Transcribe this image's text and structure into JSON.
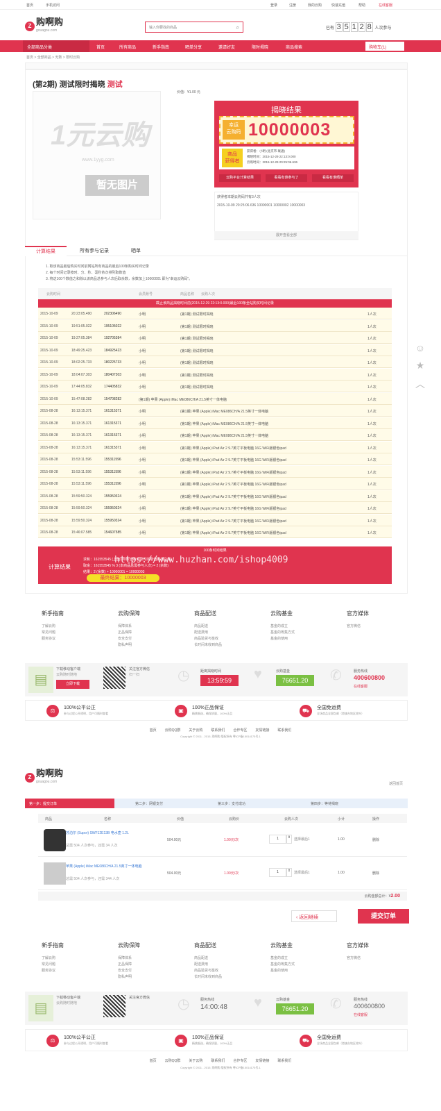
{
  "top_links": {
    "left1": "首页",
    "left2": "手机访问",
    "r1": "登录",
    "r2": "注册",
    "r3": "我的云购",
    "r4": "快速充值",
    "r5": "帮助",
    "r6": "在线客服"
  },
  "logo": {
    "mark": "Z",
    "name": "购啊购",
    "sub": "gouagou.com"
  },
  "search": {
    "placeholder": "输入你要找的商品"
  },
  "counter": {
    "prefix": "已有",
    "digits": [
      "3",
      "5",
      "1",
      "2",
      "8"
    ],
    "suffix": "人次参与"
  },
  "nav": {
    "all": "全部商品分类",
    "items": [
      "首页",
      "所有商品",
      "新手指南",
      "晒单分享",
      "邀请好友",
      "限时揭晓",
      "商品搜索"
    ],
    "cart": "购物车(1)"
  },
  "breadcrumb": "首页 > 全部商品 > 无数 > 限时云购",
  "product": {
    "period": "(第2期)",
    "title": "测试限时揭晓",
    "tag": "测试",
    "price": "价值：¥1.00 元",
    "no_image": "暂无图片",
    "brand": "1元云购",
    "brand_url": "www.1yyg.com"
  },
  "result": {
    "title": "揭晓结果",
    "lucky1": "幸运",
    "lucky2": "云购码",
    "code": "10000003",
    "winner1": "商品",
    "winner2": "获得者",
    "info1": "获得者：小明 (北京市 联通)",
    "info2": "揭晓时间：2015-12-29 22:13:0.000",
    "info3": "云购时间：2015-12-29 20:25:06.636",
    "btn1": "云购平台计算结果",
    "btn2": "看看有谁参与了",
    "btn3": "看看有谁晒单",
    "codes_title": "获得者本期云购码共有3人次",
    "codes": "2015-10-09 20:25:06.636  10000001  10000002  10000003",
    "more": "展开查看全部"
  },
  "tabs": [
    "计算结果",
    "所有参与记录",
    "晒单"
  ],
  "rules": [
    "1. 取该商品最后购买时间前网站所有商品的最后100条购买时间记录",
    "2. 每个时间记录按时、分、秒、毫秒依次排列取数值",
    "3. 将这100个数值之和除以该商品总参与人次后取余数，余数加上10000001 即为\"幸运云购码\"。"
  ],
  "table_header": [
    "云购时间",
    "会员账号",
    "商品名称",
    "云购人次"
  ],
  "table_banner": "截止该商品揭晓时间前(2015-12-29 22:13:0.000)最后100条全站购买时间记录",
  "records": [
    [
      "2015-10-09",
      "20:23:05.490",
      "202306490",
      "小明",
      "(第1期) 测试限时揭晓",
      "1人次"
    ],
    [
      "2015-10-09",
      "19:51:05.022",
      "195105022",
      "小明",
      "(第1期) 测试限时揭晓",
      "1人次"
    ],
    [
      "2015-10-09",
      "19:27:05.384",
      "192705384",
      "小明",
      "(第1期) 测试限时揭晓",
      "1人次"
    ],
    [
      "2015-10-09",
      "18:49:25.423",
      "184925423",
      "小明",
      "(第1期) 测试限时揭晓",
      "1人次"
    ],
    [
      "2015-10-09",
      "18:02:25.733",
      "180225733",
      "小明",
      "(第1期) 测试限时揭晓",
      "1人次"
    ],
    [
      "2015-10-09",
      "18:04:07.303",
      "180407303",
      "小明",
      "(第1期) 测试限时揭晓",
      "1人次"
    ],
    [
      "2015-10-09",
      "17:44:05.832",
      "174405832",
      "小明",
      "(第1期) 测试限时揭晓",
      "1人次"
    ],
    [
      "2015-10-09",
      "15:47:08.282",
      "154708282",
      "(第1期) 苹果 (Apple) iMac ME086CH/A 21.5英寸一体电脑",
      "",
      "1人次"
    ],
    [
      "2015-08-28",
      "16:13:15.371",
      "161315371",
      "小明",
      "(第1期) 苹果 (Apple) iMac ME086CH/A 21.5英寸一体电脑",
      "1人次"
    ],
    [
      "2015-08-28",
      "16:13:15.371",
      "161315371",
      "小明",
      "(第1期) 苹果 (Apple) iMac ME086CH/A 21.5英寸一体电脑",
      "1人次"
    ],
    [
      "2015-08-28",
      "16:13:15.371",
      "161315371",
      "小明",
      "(第1期) 苹果 (Apple) iMac ME086CH/A 21.5英寸一体电脑",
      "1人次"
    ],
    [
      "2015-08-28",
      "16:13:15.371",
      "161315371",
      "小明",
      "(第1期) 苹果 (Apple) iPad Air 2 9.7英寸平板电脑 16G WiFi版银色ipad",
      "1人次"
    ],
    [
      "2015-08-28",
      "15:53:11.596",
      "155311596",
      "小明",
      "(第1期) 苹果 (Apple) iPad Air 2 9.7英寸平板电脑 16G WiFi版银色ipad",
      "1人次"
    ],
    [
      "2015-08-28",
      "15:53:11.596",
      "155311596",
      "小明",
      "(第1期) 苹果 (Apple) iPad Air 2 9.7英寸平板电脑 16G WiFi版银色ipad",
      "1人次"
    ],
    [
      "2015-08-28",
      "15:53:11.596",
      "155311596",
      "小明",
      "(第1期) 苹果 (Apple) iPad Air 2 9.7英寸平板电脑 16G WiFi版银色ipad",
      "1人次"
    ],
    [
      "2015-08-28",
      "15:59:50.324",
      "155950324",
      "小明",
      "(第1期) 苹果 (Apple) iPad Air 2 9.7英寸平板电脑 16G WiFi版银色ipad",
      "1人次"
    ],
    [
      "2015-08-28",
      "15:59:50.324",
      "155950324",
      "小明",
      "(第1期) 苹果 (Apple) iPad Air 2 9.7英寸平板电脑 16G WiFi版银色ipad",
      "1人次"
    ],
    [
      "2015-08-28",
      "15:59:50.324",
      "155950324",
      "小明",
      "(第1期) 苹果 (Apple) iPad Air 2 9.7英寸平板电脑 16G WiFi版银色ipad",
      "1人次"
    ],
    [
      "2015-08-28",
      "15:46:07.585",
      "154607585",
      "小明",
      "(第1期) 苹果 (Apple) iPad Air 2 9.7英寸平板电脑 16G WiFi版银色ipad",
      "1人次"
    ]
  ],
  "table_footer": "100条时间结果",
  "calc": {
    "label": "计算结果",
    "step1": "求和：161553545 (上面100条云购记录时间取值相加之和)",
    "step2": "取余：161553545 % 3 (本商品总需参与人次) = 2 (余数)",
    "step3": "结果：2 (余数) + 10000001 = 10000003",
    "final": "最终结果：10000003",
    "watermark": "https://www.huzhan.com/ishop4009"
  },
  "footer": {
    "cols": [
      {
        "title": "新手指南",
        "items": [
          "了解云购",
          "常见问题",
          "服务协议"
        ]
      },
      {
        "title": "云购保障",
        "items": [
          "保障体系",
          "正品保障",
          "安全支付",
          "隐私声明"
        ]
      },
      {
        "title": "商品配送",
        "items": [
          "商品配送",
          "配送费用",
          "商品验货与签收",
          "长时间未收到商品"
        ]
      },
      {
        "title": "云购基金",
        "items": [
          "基金的成立",
          "基金的筹集方式",
          "基金的使用"
        ]
      },
      {
        "title": "官方媒体",
        "items": [
          "官方微信"
        ]
      }
    ],
    "app_title": "下载移动客户端",
    "app_sub": "云购随时随地",
    "app_btn": "立即下载",
    "wx_title": "关注官方微信",
    "wx_sub": "扫一扫",
    "countdown_label": "距离揭晓时间",
    "countdown": "13:59:59",
    "fund_label": "云购基金",
    "fund": "76651.20",
    "service_label": "服务热线",
    "phone": "400600800",
    "online": "在线客服",
    "g1": "100%公平公正",
    "g1s": "参与过程公开透明，用户可随时查看",
    "g2": "100%正品保证",
    "g2s": "精挑细选，确保质量，100%正品",
    "g3": "全国免运费",
    "g3s": "全场商品全国包邮（港澳台地区除外）",
    "links": [
      "首页",
      "云购QQ群",
      "关于云购",
      "联系我们",
      "合作专区",
      "友情链接",
      "联系我们"
    ],
    "copyright": "Copyright © 2011 - 2015, 购啊购 版权所有 粤ICP备15014175号-1"
  },
  "cart_page": {
    "help": "返回首页",
    "steps": [
      "第一步：提交订单",
      "第二步：网银支付",
      "第三步：支付成功",
      "第四步：等待揭晓"
    ],
    "headers": [
      "商品",
      "名称",
      "价值",
      "云购价",
      "云购人次",
      "小计",
      "操作"
    ],
    "items": [
      {
        "name": "苏泊尔 (Supor) SWF12E13B 电水壶 1.2L",
        "info": "总需 504 人次参与，还需 34 人次",
        "value": "504.00元",
        "price": "1.00元/次",
        "qty": "1",
        "sub": "1.00",
        "op": "删除"
      },
      {
        "name": "苹果 (Apple) iMac ME086CH/A 21.5英寸一体电脑",
        "info": "总需 504 人次参与，还需 344 人次",
        "value": "504.00元",
        "price": "1.00元/次",
        "qty": "1",
        "sub": "1.00",
        "op": "删除"
      }
    ],
    "total_label": "云购金额总计：¥",
    "total": "2.00",
    "back": "返回继续",
    "submit": "提交订单",
    "last": "选择最后1"
  }
}
